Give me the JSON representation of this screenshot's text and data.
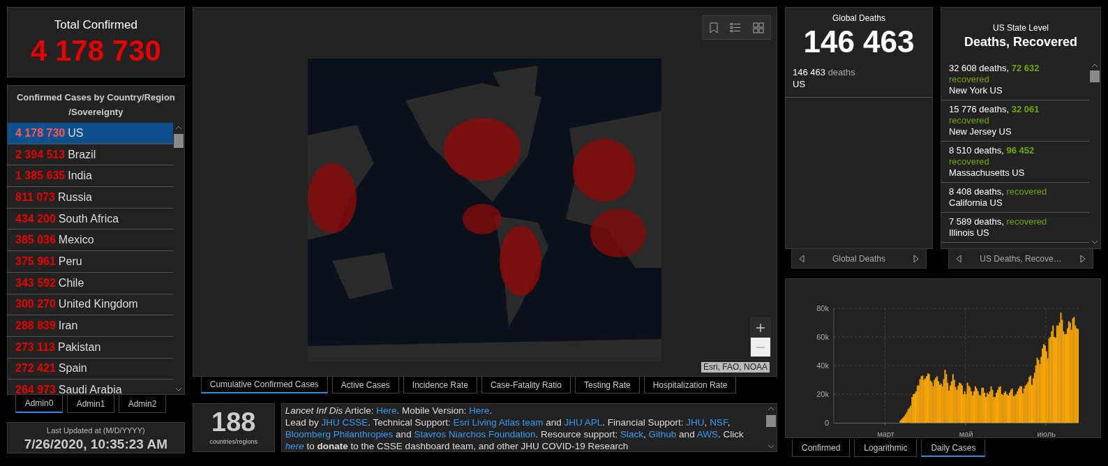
{
  "total_confirmed": {
    "title": "Total Confirmed",
    "value": "4 178 730"
  },
  "country_list": {
    "title": "Confirmed Cases by Country/Region /Sovereignty",
    "rows": [
      {
        "count": "4 178 730",
        "name": "US",
        "selected": true
      },
      {
        "count": "2 394 513",
        "name": "Brazil",
        "selected": false
      },
      {
        "count": "1 385 635",
        "name": "India",
        "selected": false
      },
      {
        "count": "811 073",
        "name": "Russia",
        "selected": false
      },
      {
        "count": "434 200",
        "name": "South Africa",
        "selected": false
      },
      {
        "count": "385 036",
        "name": "Mexico",
        "selected": false
      },
      {
        "count": "375 961",
        "name": "Peru",
        "selected": false
      },
      {
        "count": "343 592",
        "name": "Chile",
        "selected": false
      },
      {
        "count": "300 270",
        "name": "United Kingdom",
        "selected": false
      },
      {
        "count": "288 839",
        "name": "Iran",
        "selected": false
      },
      {
        "count": "273 113",
        "name": "Pakistan",
        "selected": false
      },
      {
        "count": "272 421",
        "name": "Spain",
        "selected": false
      },
      {
        "count": "264 973",
        "name": "Saudi Arabia",
        "selected": false
      }
    ]
  },
  "admin_tabs": [
    {
      "label": "Admin0",
      "selected": true
    },
    {
      "label": "Admin1",
      "selected": false
    },
    {
      "label": "Admin2",
      "selected": false
    }
  ],
  "last_updated": {
    "label": "Last Updated at (M/D/YYYY)",
    "value": "7/26/2020, 10:35:23 AM"
  },
  "map": {
    "attribution": "Esri, FAO, NOAA"
  },
  "map_tabs": [
    {
      "label": "Cumulative Confirmed Cases",
      "selected": true
    },
    {
      "label": "Active Cases",
      "selected": false
    },
    {
      "label": "Incidence Rate",
      "selected": false
    },
    {
      "label": "Case-Fatality Ratio",
      "selected": false
    },
    {
      "label": "Testing Rate",
      "selected": false
    },
    {
      "label": "Hospitalization Rate",
      "selected": false
    }
  ],
  "countries_count": {
    "value": "188",
    "label": "countries/regions"
  },
  "info_paragraphs": [
    [
      {
        "kind": "italic",
        "text": "Lancet Inf Dis"
      },
      {
        "kind": "plain",
        "text": " Article: "
      },
      {
        "kind": "link",
        "text": "Here"
      },
      {
        "kind": "plain",
        "text": ". Mobile Version: "
      },
      {
        "kind": "link",
        "text": "Here"
      },
      {
        "kind": "plain",
        "text": "."
      }
    ],
    [
      {
        "kind": "plain",
        "text": "Lead by "
      },
      {
        "kind": "link",
        "text": "JHU CSSE"
      },
      {
        "kind": "plain",
        "text": ". Technical Support: "
      },
      {
        "kind": "link",
        "text": "Esri Living Atlas team"
      },
      {
        "kind": "plain",
        "text": " and "
      },
      {
        "kind": "link",
        "text": "JHU APL"
      },
      {
        "kind": "plain",
        "text": ". Financial Support: "
      },
      {
        "kind": "link",
        "text": "JHU"
      },
      {
        "kind": "plain",
        "text": ", "
      },
      {
        "kind": "link",
        "text": "NSF"
      },
      {
        "kind": "plain",
        "text": ", "
      },
      {
        "kind": "link",
        "text": "Bloomberg Philanthropies"
      },
      {
        "kind": "plain",
        "text": " and "
      },
      {
        "kind": "link",
        "text": "Stavros Niarchos Foundation"
      },
      {
        "kind": "plain",
        "text": ". Resource support: "
      },
      {
        "kind": "link",
        "text": "Slack"
      },
      {
        "kind": "plain",
        "text": ", "
      },
      {
        "kind": "link",
        "text": "Github"
      },
      {
        "kind": "plain",
        "text": " and "
      },
      {
        "kind": "link",
        "text": "AWS"
      },
      {
        "kind": "plain",
        "text": ". Click "
      },
      {
        "kind": "italic_link",
        "text": "here"
      },
      {
        "kind": "plain",
        "text": " to "
      },
      {
        "kind": "bold",
        "text": "donate"
      },
      {
        "kind": "plain",
        "text": " to the CSSE dashboard team, and other JHU COVID-19 Research"
      }
    ]
  ],
  "global_deaths": {
    "title": "Global Deaths",
    "value": "146 463",
    "items": [
      {
        "count": "146 463",
        "unit": "deaths",
        "place": "US"
      }
    ],
    "nav_label": "Global Deaths"
  },
  "us_state": {
    "subtitle": "US State Level",
    "title": "Deaths, Recovered",
    "items": [
      {
        "deaths": "32 608 deaths,",
        "recovered_count": "72 632",
        "recovered_label": "recovered",
        "place": "New York US"
      },
      {
        "deaths": "15 776 deaths,",
        "recovered_count": "32 061",
        "recovered_label": "recovered",
        "place": "New Jersey US"
      },
      {
        "deaths": "8 510 deaths,",
        "recovered_count": "96 452",
        "recovered_label": "recovered",
        "place": "Massachusetts US"
      },
      {
        "deaths": "8 408 deaths,",
        "recovered_label": "recovered",
        "place": "California US"
      },
      {
        "deaths": "7 589 deaths,",
        "recovered_label": "recovered",
        "place": "Illinois US"
      }
    ],
    "nav_label": "US Deaths, Recove…"
  },
  "chart_tabs": [
    {
      "label": "Confirmed",
      "selected": false
    },
    {
      "label": "Logarithmic",
      "selected": false
    },
    {
      "label": "Daily Cases",
      "selected": true
    }
  ],
  "chart_data": {
    "type": "bar",
    "grid": true,
    "ylim": [
      0,
      80000
    ],
    "categories": [
      null,
      null,
      null,
      null,
      null,
      null,
      null,
      null,
      null,
      null,
      null,
      null,
      null,
      null,
      null,
      null,
      null,
      null,
      null,
      null,
      null,
      null,
      null,
      null,
      null,
      null,
      null,
      null,
      null,
      null,
      null,
      null,
      null,
      null,
      null,
      null,
      null,
      null,
      null,
      "март",
      null,
      null,
      null,
      null,
      null,
      null,
      null,
      null,
      null,
      null,
      null,
      null,
      null,
      null,
      null,
      null,
      null,
      null,
      null,
      null,
      null,
      null,
      null,
      null,
      null,
      null,
      null,
      null,
      null,
      null,
      null,
      null,
      null,
      null,
      null,
      null,
      null,
      null,
      null,
      null,
      null,
      null,
      null,
      null,
      null,
      null,
      null,
      null,
      null,
      null,
      null,
      null,
      null,
      null,
      null,
      null,
      null,
      null,
      null,
      null,
      "май",
      null,
      null,
      null,
      null,
      null,
      null,
      null,
      null,
      null,
      null,
      null,
      null,
      null,
      null,
      null,
      null,
      null,
      null,
      null,
      null,
      null,
      null,
      null,
      null,
      null,
      null,
      null,
      null,
      null,
      null,
      null,
      null,
      null,
      null,
      null,
      null,
      null,
      null,
      null,
      null,
      null,
      null,
      null,
      null,
      null,
      null,
      null,
      null,
      null,
      null,
      null,
      null,
      null,
      null,
      null,
      null,
      null,
      null,
      null,
      null,
      "июль",
      null,
      null,
      null,
      null,
      null,
      null,
      null,
      null,
      null,
      null,
      null,
      null,
      null,
      null,
      null,
      null,
      null,
      null,
      null,
      null,
      null,
      null,
      null,
      null
    ],
    "yticks": [
      {
        "value": 0,
        "label": "0"
      },
      {
        "value": 20000,
        "label": "20k"
      },
      {
        "value": 40000,
        "label": "40k"
      },
      {
        "value": 60000,
        "label": "60k"
      },
      {
        "value": 80000,
        "label": "80k"
      }
    ],
    "series": [
      {
        "color": "#ffaa00",
        "values": [
          0,
          0,
          0,
          0,
          0,
          0,
          0,
          0,
          0,
          0,
          0,
          0,
          0,
          0,
          0,
          0,
          0,
          0,
          0,
          0,
          0,
          0,
          0,
          0,
          0,
          0,
          0,
          0,
          0,
          0,
          0,
          0,
          0,
          0,
          0,
          0,
          0,
          0,
          0,
          0,
          0,
          0,
          0,
          0,
          0,
          0,
          0,
          0,
          0,
          0,
          1500,
          2500,
          3500,
          4500,
          6000,
          7500,
          9500,
          10500,
          12000,
          18000,
          20000,
          20500,
          22000,
          26000,
          26000,
          30500,
          32500,
          33000,
          30000,
          31000,
          32500,
          34500,
          34000,
          29500,
          28500,
          25500,
          30000,
          31500,
          32500,
          29000,
          26500,
          27500,
          25500,
          30500,
          37000,
          34000,
          28000,
          22500,
          26000,
          29000,
          34000,
          30000,
          25000,
          23000,
          26000,
          28000,
          27500,
          26000,
          20000,
          22000,
          20000,
          28000,
          26000,
          25000,
          22000,
          19000,
          22000,
          25500,
          24000,
          22000,
          19500,
          19000,
          24500,
          24500,
          21000,
          18000,
          21000,
          20000,
          22000,
          25500,
          23000,
          18000,
          18000,
          21000,
          23000,
          25000,
          25500,
          20000,
          19500,
          21000,
          22000,
          20000,
          19000,
          21000,
          23000,
          24000,
          18500,
          19000,
          20000,
          22000,
          24000,
          25500,
          25500,
          20500,
          24000,
          26000,
          27000,
          28500,
          32000,
          33000,
          26500,
          31000,
          35000,
          40000,
          45500,
          44000,
          41000,
          46000,
          52000,
          55000,
          54000,
          50000,
          45000,
          59000,
          60000,
          64000,
          68000,
          60000,
          59500,
          68000,
          68000,
          70000,
          77000,
          72000,
          64000,
          62000,
          62000,
          66000,
          71000,
          70000,
          65000,
          73000,
          74000,
          68000,
          66000,
          65500
        ]
      }
    ]
  }
}
